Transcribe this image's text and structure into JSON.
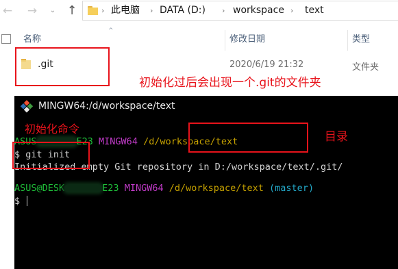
{
  "explorer": {
    "nav": {
      "back_icon": "arrow-left-icon",
      "forward_icon": "arrow-right-icon",
      "dropdown_icon": "chevron-down-icon",
      "up_icon": "arrow-up-icon",
      "back_glyph": "←",
      "forward_glyph": "→",
      "dropdown_glyph": "⌄",
      "up_glyph": "↑"
    },
    "breadcrumb": {
      "separator": "›",
      "items": [
        "此电脑",
        "DATA (D:)",
        "workspace",
        "text"
      ]
    },
    "columns": {
      "name": "名称",
      "modified": "修改日期",
      "type": "类型"
    },
    "files": [
      {
        "name": ".git",
        "modified": "2020/6/19 21:32",
        "type": "文件夹"
      }
    ]
  },
  "terminal": {
    "title": "MINGW64:/d/workspace/text",
    "prompt_user_visible": "ASUS@DESK",
    "prompt_user_fragment_1": "ASUS",
    "prompt_host_suffix": "E23",
    "prompt_host_suffix_2": "E23",
    "prompt_env": "MINGW64",
    "prompt_path": "/d/workspace/text",
    "branch": "(master)",
    "command": "$ git init",
    "output": "Initialized empty Git repository in D:/workspace/text/.git/",
    "prompt_symbol": "$"
  },
  "annotations": {
    "git_folder_note": "初始化过后会出现一个.git的文件夹",
    "init_command_note": "初始化命令",
    "directory_note": "目录"
  },
  "colors": {
    "annotation_red": "#e8131b",
    "terminal_bg": "#000000",
    "prompt_green": "#1fc13a",
    "prompt_purple": "#c23bc9",
    "path_yellow": "#c4a000",
    "branch_cyan": "#23a9c9",
    "folder_yellow": "#f6cf5b"
  }
}
